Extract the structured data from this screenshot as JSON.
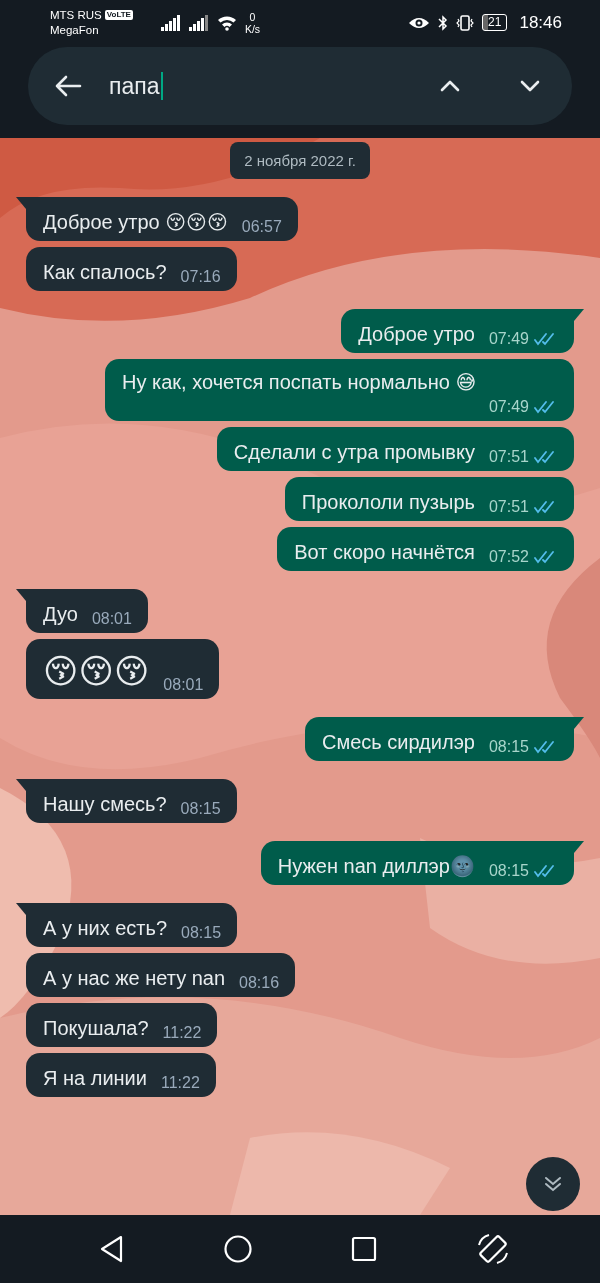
{
  "status_bar": {
    "carrier_1": "MTS RUS",
    "volte": "VoLTE",
    "carrier_2": "MegaFon",
    "speed_value": "0",
    "speed_unit": "K/s",
    "battery": "21",
    "time": "18:46"
  },
  "search": {
    "query": "папа"
  },
  "date_separator": "2 ноября 2022 г.",
  "messages": [
    {
      "outgoing": false,
      "kind": "text",
      "tail": true,
      "text": "Доброе утро 😚😚😚",
      "time": "06:57"
    },
    {
      "outgoing": false,
      "kind": "text",
      "tail": false,
      "text": "Как спалось?",
      "time": "07:16"
    },
    {
      "outgoing": true,
      "kind": "text",
      "tail": true,
      "text": "Доброе утро",
      "time": "07:49",
      "read": true
    },
    {
      "outgoing": true,
      "kind": "text",
      "tail": false,
      "text": "Ну как, хочется поспать нормально 😅",
      "time": "07:49",
      "read": true
    },
    {
      "outgoing": true,
      "kind": "text",
      "tail": false,
      "text": "Сделали с утра промывку",
      "time": "07:51",
      "read": true
    },
    {
      "outgoing": true,
      "kind": "text",
      "tail": false,
      "text": "Прокололи пузырь",
      "time": "07:51",
      "read": true
    },
    {
      "outgoing": true,
      "kind": "text",
      "tail": false,
      "text": "Вот скоро начнётся",
      "time": "07:52",
      "read": true
    },
    {
      "outgoing": false,
      "kind": "text",
      "tail": true,
      "text": "Дуо",
      "time": "08:01"
    },
    {
      "outgoing": false,
      "kind": "emoji",
      "tail": false,
      "text": "😚😚😚",
      "time": "08:01"
    },
    {
      "outgoing": true,
      "kind": "text",
      "tail": true,
      "text": "Смесь сирдилэр",
      "time": "08:15",
      "read": true
    },
    {
      "outgoing": false,
      "kind": "text",
      "tail": true,
      "text": "Нашу смесь?",
      "time": "08:15"
    },
    {
      "outgoing": true,
      "kind": "text",
      "tail": true,
      "text": "Нужен nan диллэр🌚",
      "time": "08:15",
      "read": true
    },
    {
      "outgoing": false,
      "kind": "text",
      "tail": true,
      "text": "А у них есть?",
      "time": "08:15"
    },
    {
      "outgoing": false,
      "kind": "text",
      "tail": false,
      "text": "А у нас же нету nan",
      "time": "08:16"
    },
    {
      "outgoing": false,
      "kind": "text",
      "tail": false,
      "text": "Покушала?",
      "time": "11:22"
    },
    {
      "outgoing": false,
      "kind": "text",
      "tail": false,
      "text": "Я на линии",
      "time": "11:22"
    }
  ]
}
